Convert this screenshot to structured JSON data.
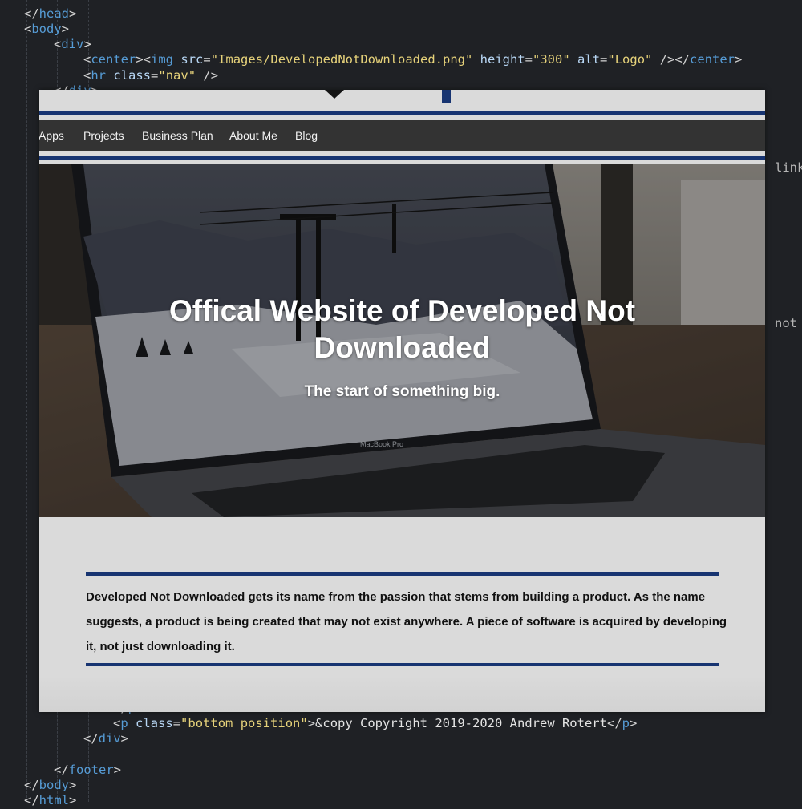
{
  "editor": {
    "lines_top": [
      [
        [
          "br",
          "</"
        ],
        [
          "tag",
          "head"
        ],
        [
          "br",
          ">"
        ]
      ],
      [
        [
          "br",
          "<"
        ],
        [
          "tag",
          "body"
        ],
        [
          "br",
          ">"
        ]
      ],
      [
        [
          "br",
          "<"
        ],
        [
          "tag",
          "div"
        ],
        [
          "br",
          ">"
        ]
      ],
      [
        [
          "br",
          "<"
        ],
        [
          "tag",
          "center"
        ],
        [
          "br",
          "><"
        ],
        [
          "tag",
          "img"
        ],
        [
          "txt",
          " "
        ],
        [
          "attr",
          "src"
        ],
        [
          "br",
          "="
        ],
        [
          "str",
          "\"Images/DevelopedNotDownloaded.png\""
        ],
        [
          "txt",
          " "
        ],
        [
          "attr",
          "height"
        ],
        [
          "br",
          "="
        ],
        [
          "str",
          "\"300\""
        ],
        [
          "txt",
          " "
        ],
        [
          "attr",
          "alt"
        ],
        [
          "br",
          "="
        ],
        [
          "str",
          "\"Logo\""
        ],
        [
          "txt",
          " "
        ],
        [
          "br",
          "/></"
        ],
        [
          "tag",
          "center"
        ],
        [
          "br",
          ">"
        ]
      ],
      [
        [
          "br",
          "<"
        ],
        [
          "tag",
          "hr"
        ],
        [
          "txt",
          " "
        ],
        [
          "attr",
          "class"
        ],
        [
          "br",
          "="
        ],
        [
          "str",
          "\"nav\""
        ],
        [
          "txt",
          " "
        ],
        [
          "br",
          "/>"
        ]
      ],
      [
        [
          "br",
          "</"
        ],
        [
          "tag",
          "div"
        ],
        [
          "br",
          ">"
        ]
      ]
    ],
    "lines_bottom": [
      [
        [
          "br",
          "</"
        ],
        [
          "tag",
          "p"
        ],
        [
          "br",
          ">"
        ]
      ],
      [
        [
          "br",
          "<"
        ],
        [
          "tag",
          "p"
        ],
        [
          "txt",
          " "
        ],
        [
          "attr",
          "class"
        ],
        [
          "br",
          "="
        ],
        [
          "str",
          "\"bottom_position\""
        ],
        [
          "br",
          ">"
        ],
        [
          "txt",
          "&copy Copyright 2019-2020 Andrew Rotert"
        ],
        [
          "br",
          "</"
        ],
        [
          "tag",
          "p"
        ],
        [
          "br",
          ">"
        ]
      ],
      [
        [
          "br",
          "</"
        ],
        [
          "tag",
          "div"
        ],
        [
          "br",
          ">"
        ]
      ],
      [],
      [
        [
          "br",
          "</"
        ],
        [
          "tag",
          "footer"
        ],
        [
          "br",
          ">"
        ]
      ],
      [
        [
          "br",
          "</"
        ],
        [
          "tag",
          "body"
        ],
        [
          "br",
          ">"
        ]
      ],
      [
        [
          "br",
          "</"
        ],
        [
          "tag",
          "html"
        ],
        [
          "br",
          ">"
        ]
      ]
    ],
    "side_fragments": [
      "link",
      "not"
    ]
  },
  "site": {
    "nav": [
      "Apps",
      "Projects",
      "Business Plan",
      "About Me",
      "Blog"
    ],
    "hero": {
      "title_line1": "Offical Website of Developed Not",
      "title_line2": "Downloaded",
      "subtitle": "The start of something big.",
      "laptop_label": "MacBook Pro"
    },
    "about": "Developed Not Downloaded gets its name from the passion that stems from building a product. As the name suggests, a product is being created that may not exist anywhere. A piece of software is acquired by developing it, not just downloading it."
  },
  "colors": {
    "editor_bg": "#1f2125",
    "tag": "#569cd6",
    "attr": "#b8d7f5",
    "string": "#e6d27a",
    "rule_blue": "#173471",
    "navbar_bg": "#333333",
    "page_bg": "#dadada"
  }
}
